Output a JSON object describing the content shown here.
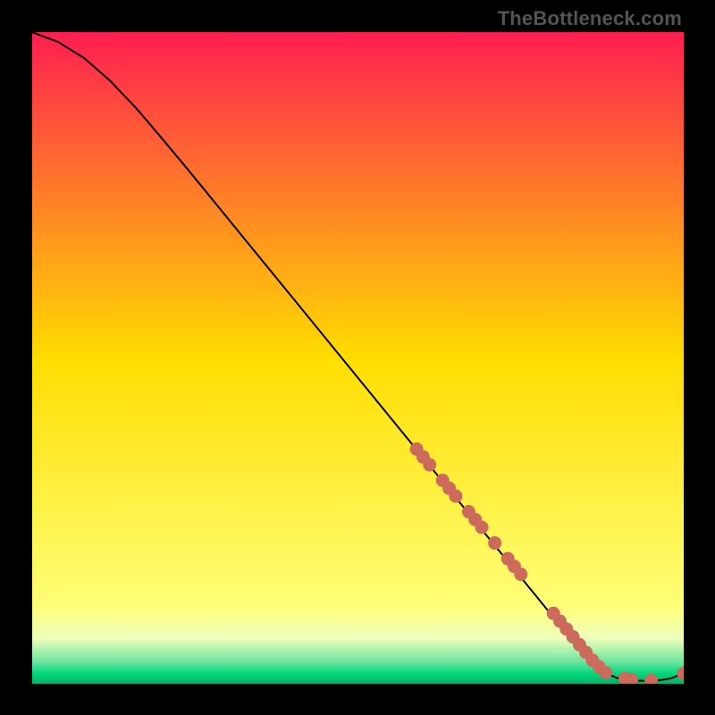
{
  "watermark": "TheBottleneck.com",
  "chart_data": {
    "type": "line",
    "title": "",
    "xlabel": "",
    "ylabel": "",
    "xlim": [
      0,
      100
    ],
    "ylim": [
      0,
      100
    ],
    "grid": false,
    "series": [
      {
        "name": "curve",
        "style": "line",
        "color": "#000000",
        "x": [
          0,
          4,
          8,
          12,
          16,
          20,
          24,
          28,
          32,
          36,
          40,
          44,
          48,
          52,
          56,
          60,
          64,
          68,
          72,
          76,
          80,
          82,
          84,
          86,
          88,
          90,
          92,
          94,
          96,
          98,
          100
        ],
        "values": [
          100,
          98.5,
          96,
          92.5,
          88.3,
          83.6,
          78.8,
          73.9,
          69,
          64.1,
          59.2,
          54.3,
          49.4,
          44.5,
          39.6,
          34.7,
          29.8,
          24.9,
          20,
          15.1,
          10.2,
          7.8,
          5.4,
          3.2,
          1.6,
          0.8,
          0.5,
          0.45,
          0.5,
          0.8,
          1.6
        ]
      },
      {
        "name": "markers",
        "style": "scatter",
        "color": "#cc6a5c",
        "x": [
          59,
          60,
          61,
          63,
          64,
          65,
          67,
          68,
          69,
          71,
          73,
          74,
          75,
          80,
          81,
          82,
          83,
          84,
          85,
          86,
          87,
          88,
          91,
          92,
          95,
          100
        ],
        "values": [
          36,
          34.8,
          33.6,
          31.2,
          30,
          28.8,
          26.4,
          25.2,
          24,
          21.6,
          19.2,
          18,
          16.8,
          10.8,
          9.6,
          8.4,
          7.2,
          6.0,
          4.8,
          3.6,
          2.6,
          1.7,
          0.8,
          0.6,
          0.5,
          1.6
        ]
      }
    ],
    "background_gradient": [
      {
        "stop": 0.0,
        "color": "#ff1e50"
      },
      {
        "stop": 0.5,
        "color": "#ffdd00"
      },
      {
        "stop": 0.88,
        "color": "#ffff77"
      },
      {
        "stop": 0.93,
        "color": "#eeffbb"
      },
      {
        "stop": 0.965,
        "color": "#74e6a0"
      },
      {
        "stop": 0.985,
        "color": "#00d67a"
      },
      {
        "stop": 1.0,
        "color": "#00b26a"
      }
    ]
  }
}
